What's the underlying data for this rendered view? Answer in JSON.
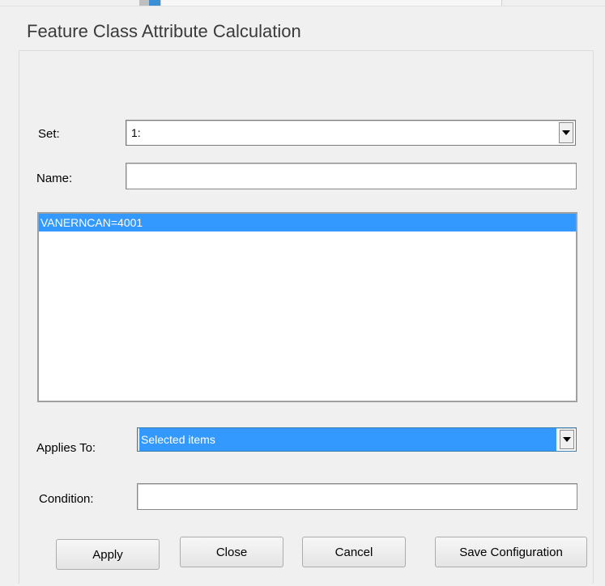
{
  "dialog": {
    "title": "Feature Class Attribute Calculation"
  },
  "form": {
    "set_label": "Set:",
    "set_value": "1:",
    "name_label": "Name:",
    "name_value": "",
    "list_items": [
      "VANERNCAN=4001"
    ],
    "applies_to_label": "Applies To:",
    "applies_to_value": "Selected items",
    "condition_label": "Condition:",
    "condition_value": ""
  },
  "buttons": {
    "apply": "Apply",
    "close": "Close",
    "cancel": "Cancel",
    "save_configuration": "Save Configuration"
  },
  "colors": {
    "selection": "#3399ff",
    "background": "#f0f0f0"
  }
}
